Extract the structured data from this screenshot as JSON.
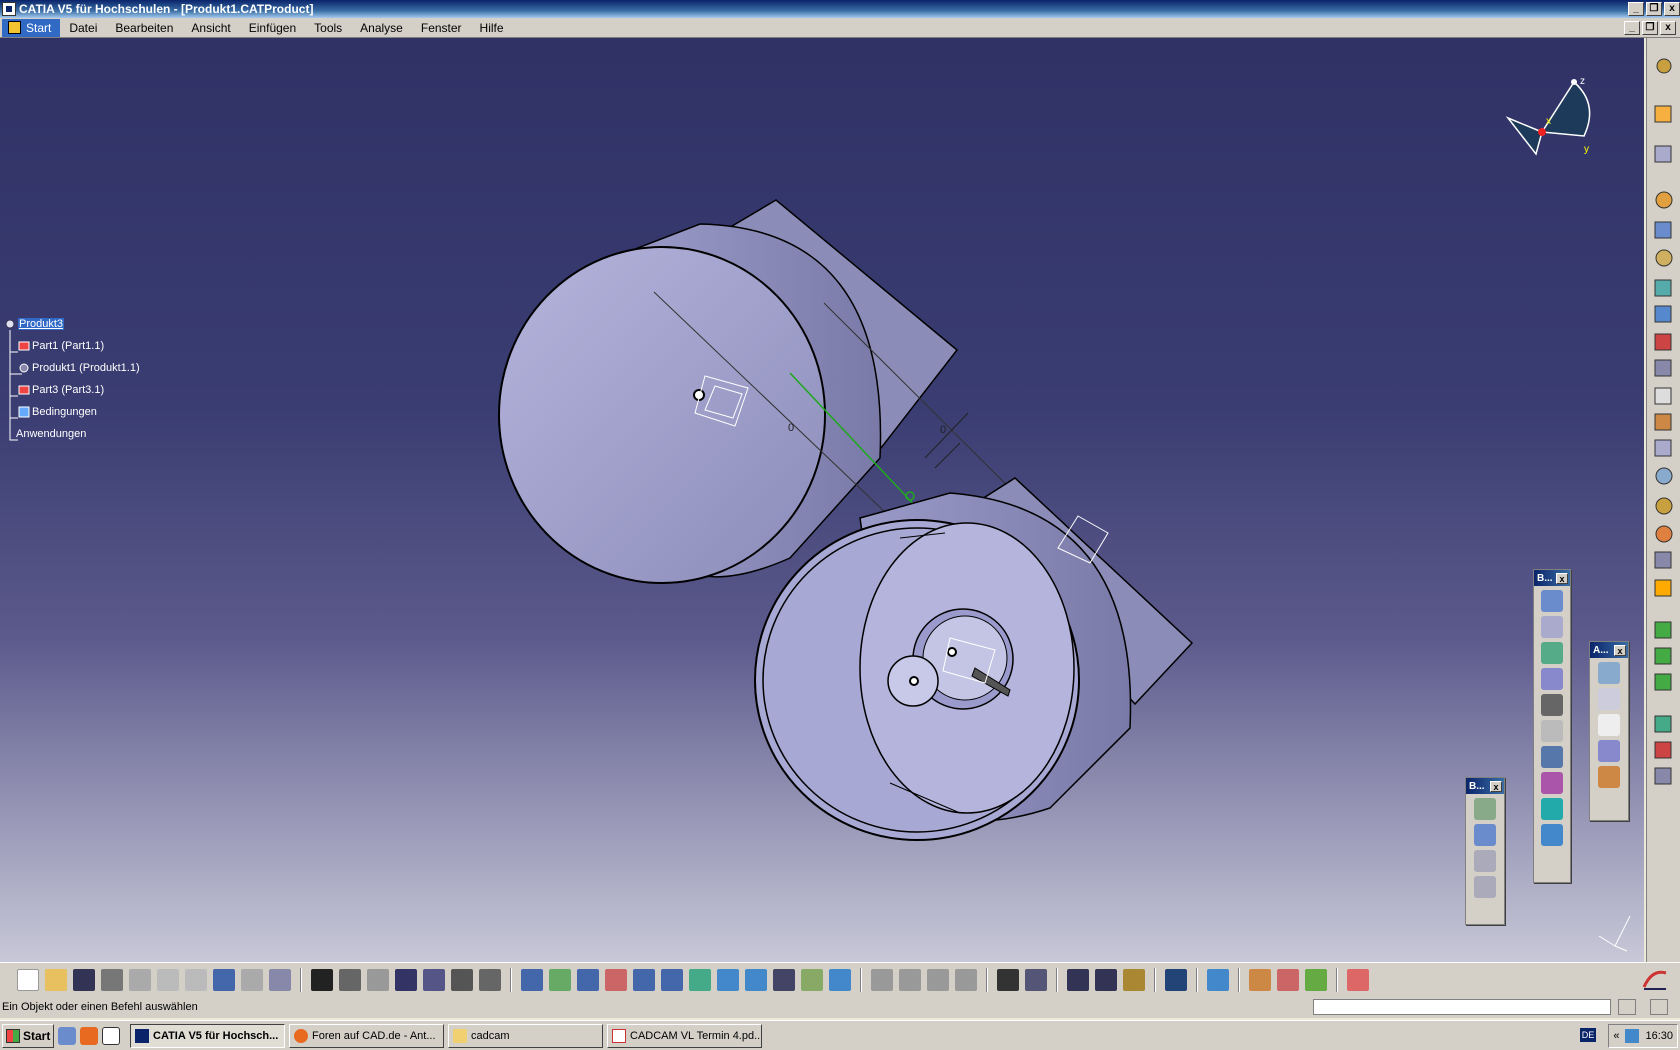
{
  "window": {
    "title": "CATIA V5 für Hochschulen - [Produkt1.CATProduct]",
    "buttons": [
      "_",
      "❐",
      "x"
    ]
  },
  "menu": {
    "items": [
      "Start",
      "Datei",
      "Bearbeiten",
      "Ansicht",
      "Einfügen",
      "Tools",
      "Analyse",
      "Fenster",
      "Hilfe"
    ]
  },
  "tree": {
    "root": "Produkt3",
    "children": [
      "Part1 (Part1.1)",
      "Produkt1 (Produkt1.1)",
      "Part3 (Part3.1)",
      "Bedingungen"
    ],
    "applications": "Anwendungen"
  },
  "compass": {
    "axes": [
      "z",
      "x",
      "y"
    ]
  },
  "model": {
    "constraint_label_1": "0",
    "constraint_label_2": "0"
  },
  "float_toolbars": [
    {
      "title": "B...",
      "close": "x"
    },
    {
      "title": "A...",
      "close": "x"
    },
    {
      "title": "B...",
      "close": "x"
    }
  ],
  "status": {
    "message": "Ein Objekt oder einen Befehl auswählen"
  },
  "taskbar": {
    "start": "Start",
    "tasks": [
      "CATIA V5 für Hochsch...",
      "Foren auf CAD.de - Ant...",
      "cadcam",
      "CADCAM VL Termin 4.pd..."
    ],
    "language": "DE",
    "clock": "16:30",
    "tray_arrow": "«"
  },
  "colors": {
    "viewport_top": "#303266",
    "viewport_bottom": "#c8c8d8",
    "part": "#aeaed6",
    "selection": "#3169c6"
  }
}
